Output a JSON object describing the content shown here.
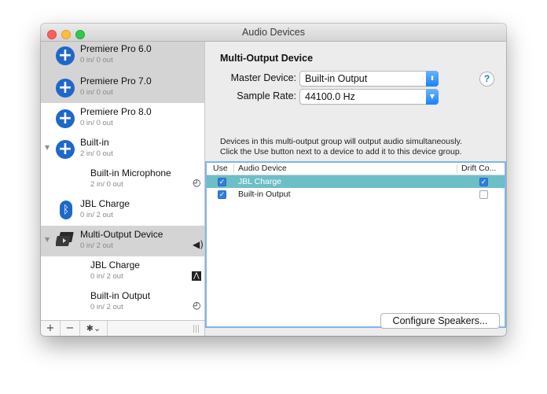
{
  "window": {
    "title": "Audio Devices"
  },
  "sidebar": {
    "devices": [
      {
        "name": "Premiere Pro 6.0",
        "io": "0 in/ 0 out",
        "icon": "aggregate-plus-icon"
      },
      {
        "name": "Premiere Pro 7.0",
        "io": "0 in/ 0 out",
        "icon": "aggregate-plus-icon"
      },
      {
        "name": "Premiere Pro 8.0",
        "io": "0 in/ 0 out",
        "icon": "aggregate-plus-icon"
      },
      {
        "name": "Built-in",
        "io": "2 in/ 0 out",
        "icon": "aggregate-plus-icon"
      },
      {
        "name": "Built-in Microphone",
        "io": "2 in/ 0 out",
        "icon": "clock-icon"
      },
      {
        "name": "JBL Charge",
        "io": "0 in/ 2 out",
        "icon": "bluetooth-icon"
      },
      {
        "name": "Multi-Output Device",
        "io": "0 in/ 2 out",
        "icon": "multi-output-icon"
      },
      {
        "name": "JBL Charge",
        "io": "0 in/ 2 out",
        "icon": "waveform-icon"
      },
      {
        "name": "Built-in Output",
        "io": "0 in/ 2 out",
        "icon": "clock-icon"
      }
    ],
    "toolbar": {
      "add_label": "+",
      "remove_label": "−",
      "gear_label": "✱⌄"
    }
  },
  "main": {
    "heading": "Multi-Output Device",
    "master_label": "Master Device:",
    "master_value": "Built-in Output",
    "rate_label": "Sample Rate:",
    "rate_value": "44100.0 Hz",
    "help_label": "?",
    "info_line1": "Devices in this multi-output group will output audio simultaneously.",
    "info_line2": "Click the Use button next to a device to add it to this device group.",
    "table": {
      "headers": {
        "use": "Use",
        "device": "Audio Device",
        "drift": "Drift Co..."
      },
      "rows": [
        {
          "use": true,
          "device": "JBL Charge",
          "drift": true
        },
        {
          "use": true,
          "device": "Built-in Output",
          "drift": false
        }
      ]
    },
    "configure_label": "Configure Speakers..."
  },
  "colors": {
    "accent": "#1f68c9",
    "selection_row": "#6cbfc6",
    "sidebar_selection": "#d4d4d4",
    "table_focus_ring": "#82b5ea"
  }
}
